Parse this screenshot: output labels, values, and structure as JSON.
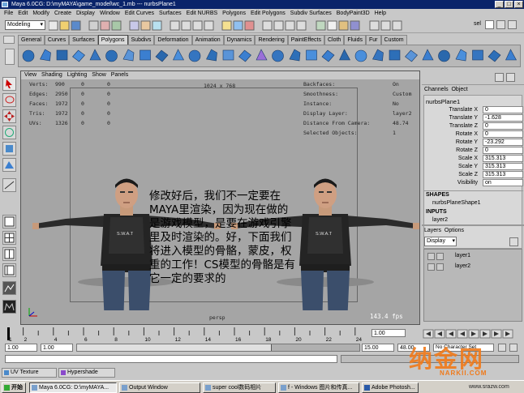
{
  "window": {
    "title": "Maya 6.0CG: D:\\myMAYA\\game_model\\wc_1.mb  ---  nurbsPlane1"
  },
  "menubar": [
    "File",
    "Edit",
    "Modify",
    "Create",
    "Display",
    "Window",
    "Edit Curves",
    "Surfaces",
    "Edit NURBS",
    "Polygons",
    "Edit Polygons",
    "Subdiv Surfaces",
    "BodyPaint3D",
    "Help"
  ],
  "statusline": {
    "mode": "Modeling",
    "sel_label": "sel"
  },
  "shelf_tabs": [
    "General",
    "Curves",
    "Surfaces",
    "Polygons",
    "Subdivs",
    "Deformation",
    "Animation",
    "Dynamics",
    "Rendering",
    "PaintEffects",
    "Cloth",
    "Fluids",
    "Fur",
    "Custom"
  ],
  "shelf_active": "Polygons",
  "panel_menu": [
    "View",
    "Shading",
    "Lighting",
    "Show",
    "Panels"
  ],
  "hud": {
    "labels": [
      "Verts:",
      "Edges:",
      "Faces:",
      "Tris:",
      "UVs:"
    ],
    "values": [
      [
        "990",
        "0",
        "0"
      ],
      [
        "2950",
        "0",
        "0"
      ],
      [
        "1972",
        "0",
        "0"
      ],
      [
        "1972",
        "0",
        "0"
      ],
      [
        "1326",
        "0",
        "0"
      ]
    ],
    "resolution": "1024 x 768",
    "right_labels": [
      "Backfaces:",
      "Smoothness:",
      "Instance:",
      "Display Layer:",
      "Distance From Camera:",
      "Selected Objects:"
    ],
    "right_values": [
      "On",
      "Custom",
      "No",
      "layer2",
      "48.74",
      "1"
    ],
    "camera": "persp",
    "fps": "143.4 fps"
  },
  "annotation": "修改好后，我们不一定要在MAYA里渲染，因为现在做的是游戏模型，是要在游戏引擎里及时渲染的。好，下面我们将进入模型的骨骼，蒙皮，权重的工作！CS模型的骨骼是有它一定的要求的",
  "character_badge": "S.W.A.T",
  "channel_box": {
    "tabs": [
      "Channels",
      "Object"
    ],
    "object": "nurbsPlane1",
    "attributes": [
      {
        "name": "Translate X",
        "value": "0"
      },
      {
        "name": "Translate Y",
        "value": "-1.628"
      },
      {
        "name": "Translate Z",
        "value": "0"
      },
      {
        "name": "Rotate X",
        "value": "0"
      },
      {
        "name": "Rotate Y",
        "value": "-23.292"
      },
      {
        "name": "Rotate Z",
        "value": "0"
      },
      {
        "name": "Scale X",
        "value": "315.313"
      },
      {
        "name": "Scale Y",
        "value": "315.313"
      },
      {
        "name": "Scale Z",
        "value": "315.313"
      },
      {
        "name": "Visibility",
        "value": "on"
      }
    ],
    "shapes_header": "SHAPES",
    "shape": "nurbsPlaneShape1",
    "inputs_header": "INPUTS",
    "input": "layer2"
  },
  "layer_editor": {
    "tabs": [
      "Layers",
      "Options"
    ],
    "display": "Display",
    "layers": [
      "layer1",
      "layer2"
    ]
  },
  "timeline": {
    "ticks": [
      "1",
      "2",
      "4",
      "6",
      "8",
      "10",
      "12",
      "14",
      "16",
      "18",
      "20",
      "22",
      "24"
    ],
    "current": "1.00",
    "start": "1.00",
    "range_start": "1.00",
    "range_end": "15.00",
    "end": "48.00",
    "character_set": "No Character Set"
  },
  "bottom": {
    "uv_texture": "UV Texture",
    "hypershade": "Hypershade"
  },
  "taskbar": {
    "start": "开始",
    "items": [
      "Maya 6.0CG: D:\\myMAYA...",
      "Output Window",
      "super cool数码相片",
      "f - Windows 图片和传真...",
      "Adobe Photosh..."
    ]
  },
  "watermark": {
    "brand": "纳金网",
    "sub": "NARKII.COM",
    "url": "www.srazw.com"
  },
  "colors": {
    "titlebar": "#0a246a",
    "viewport": "#a5a5a5",
    "watermark": "#f07a1a"
  }
}
